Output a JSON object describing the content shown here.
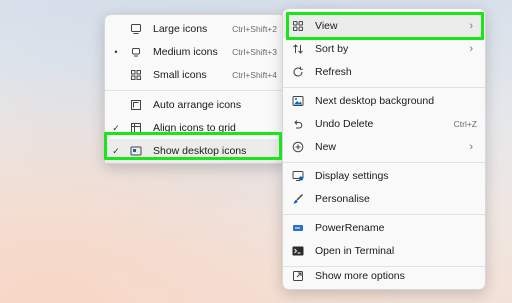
{
  "submenu": {
    "items": [
      {
        "name": "large-icons",
        "label": "Large icons",
        "shortcut": "Ctrl+Shift+2",
        "bullet": "",
        "icon": "monitor-icon"
      },
      {
        "name": "medium-icons",
        "label": "Medium icons",
        "shortcut": "Ctrl+Shift+3",
        "bullet": "•",
        "icon": "monitor-small-icon"
      },
      {
        "name": "small-icons",
        "label": "Small icons",
        "shortcut": "Ctrl+Shift+4",
        "bullet": "",
        "icon": "grid-icon"
      },
      {
        "name": "auto-arrange-icons",
        "label": "Auto arrange icons",
        "shortcut": "",
        "bullet": "",
        "icon": "arrange-icon"
      },
      {
        "name": "align-icons-to-grid",
        "label": "Align icons to grid",
        "shortcut": "",
        "bullet": "✓",
        "icon": "align-grid-icon"
      },
      {
        "name": "show-desktop-icons",
        "label": "Show desktop icons",
        "shortcut": "",
        "bullet": "✓",
        "icon": "desktop-icon"
      }
    ]
  },
  "mainmenu": {
    "items": [
      {
        "name": "view",
        "label": "View",
        "shortcut": "",
        "submenu": "›",
        "icon": "grid-view-icon"
      },
      {
        "name": "sort-by",
        "label": "Sort by",
        "shortcut": "",
        "submenu": "›",
        "icon": "sort-icon"
      },
      {
        "name": "refresh",
        "label": "Refresh",
        "shortcut": "",
        "submenu": "",
        "icon": "refresh-icon"
      },
      {
        "name": "next-desktop-background",
        "label": "Next desktop background",
        "shortcut": "",
        "submenu": "",
        "icon": "next-background-icon"
      },
      {
        "name": "undo-delete",
        "label": "Undo Delete",
        "shortcut": "Ctrl+Z",
        "submenu": "",
        "icon": "undo-icon"
      },
      {
        "name": "new",
        "label": "New",
        "shortcut": "",
        "submenu": "›",
        "icon": "plus-circle-icon"
      },
      {
        "name": "display-settings",
        "label": "Display settings",
        "shortcut": "",
        "submenu": "",
        "icon": "display-settings-icon"
      },
      {
        "name": "personalise",
        "label": "Personalise",
        "shortcut": "",
        "submenu": "",
        "icon": "brush-icon"
      },
      {
        "name": "powerrename",
        "label": "PowerRename",
        "shortcut": "",
        "submenu": "",
        "icon": "powerrename-icon"
      },
      {
        "name": "open-in-terminal",
        "label": "Open in Terminal",
        "shortcut": "",
        "submenu": "",
        "icon": "terminal-icon"
      },
      {
        "name": "show-more-options",
        "label": "Show more options",
        "shortcut": "",
        "submenu": "",
        "icon": "more-options-icon"
      }
    ]
  },
  "colors": {
    "highlight": "#19e619",
    "accent": "#0067c0"
  }
}
